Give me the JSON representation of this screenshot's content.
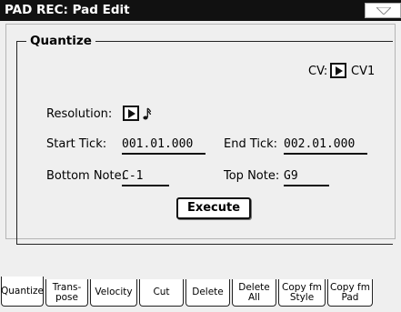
{
  "window": {
    "title": "PAD REC: Pad Edit",
    "menu_icon": "triangle-down-icon"
  },
  "quantize": {
    "group_title": "Quantize",
    "cv_label": "CV:",
    "cv_value": "CV1",
    "resolution_label": "Resolution:",
    "resolution_icon": "sixteenth-note-icon",
    "start_tick_label": "Start Tick:",
    "start_tick_value": "001.01.000",
    "end_tick_label": "End Tick:",
    "end_tick_value": "002.01.000",
    "bottom_note_label": "Bottom Note:",
    "bottom_note_value": "C-1",
    "top_note_label": "Top Note:",
    "top_note_value": "G9",
    "execute_label": "Execute"
  },
  "tabs": [
    {
      "line1": "Quantize",
      "line2": "",
      "active": true
    },
    {
      "line1": "Trans-",
      "line2": "pose",
      "active": false
    },
    {
      "line1": "Velocity",
      "line2": "",
      "active": false
    },
    {
      "line1": "Cut",
      "line2": "",
      "active": false
    },
    {
      "line1": "Delete",
      "line2": "",
      "active": false
    },
    {
      "line1": "Delete",
      "line2": "All",
      "active": false
    },
    {
      "line1": "Copy fm",
      "line2": "Style",
      "active": false
    },
    {
      "line1": "Copy fm",
      "line2": "Pad",
      "active": false
    }
  ]
}
